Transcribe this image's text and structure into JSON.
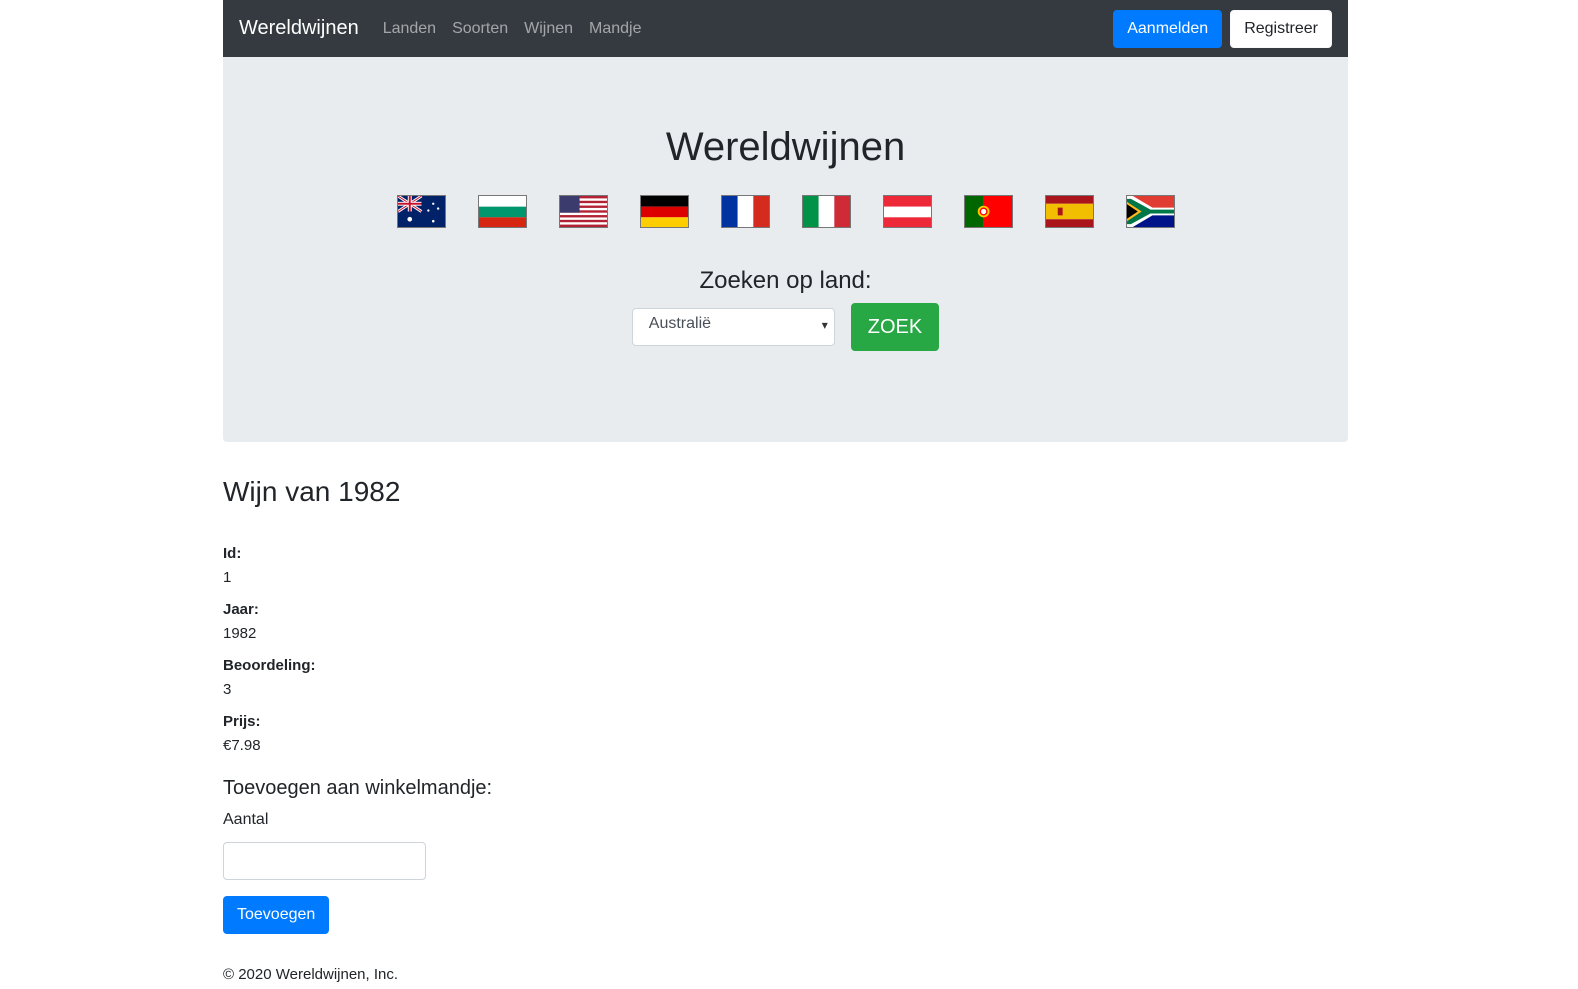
{
  "navbar": {
    "brand": "Wereldwijnen",
    "links": [
      "Landen",
      "Soorten",
      "Wijnen",
      "Mandje"
    ],
    "login_label": "Aanmelden",
    "register_label": "Registreer"
  },
  "hero": {
    "title": "Wereldwijnen",
    "flags": [
      "australia",
      "bulgaria",
      "usa",
      "germany",
      "france",
      "italy",
      "austria",
      "portugal",
      "spain",
      "south-africa"
    ],
    "search_label": "Zoeken op land:",
    "search_selected": "Australië",
    "search_button": "ZOEK"
  },
  "wine": {
    "title": "Wijn van 1982",
    "fields": [
      {
        "label": "Id:",
        "value": "1"
      },
      {
        "label": "Jaar:",
        "value": "1982"
      },
      {
        "label": "Beoordeling:",
        "value": "3"
      },
      {
        "label": "Prijs:",
        "value": "€7.98"
      }
    ]
  },
  "cart": {
    "title": "Toevoegen aan winkelmandje:",
    "quantity_label": "Aantal",
    "quantity_value": "",
    "add_button": "Toevoegen"
  },
  "footer": {
    "text": "© 2020 Wereldwijnen, Inc."
  },
  "colors": {
    "navbar_bg": "#343a40",
    "primary": "#007bff",
    "success": "#28a745",
    "jumbotron_bg": "#e9ecef"
  }
}
